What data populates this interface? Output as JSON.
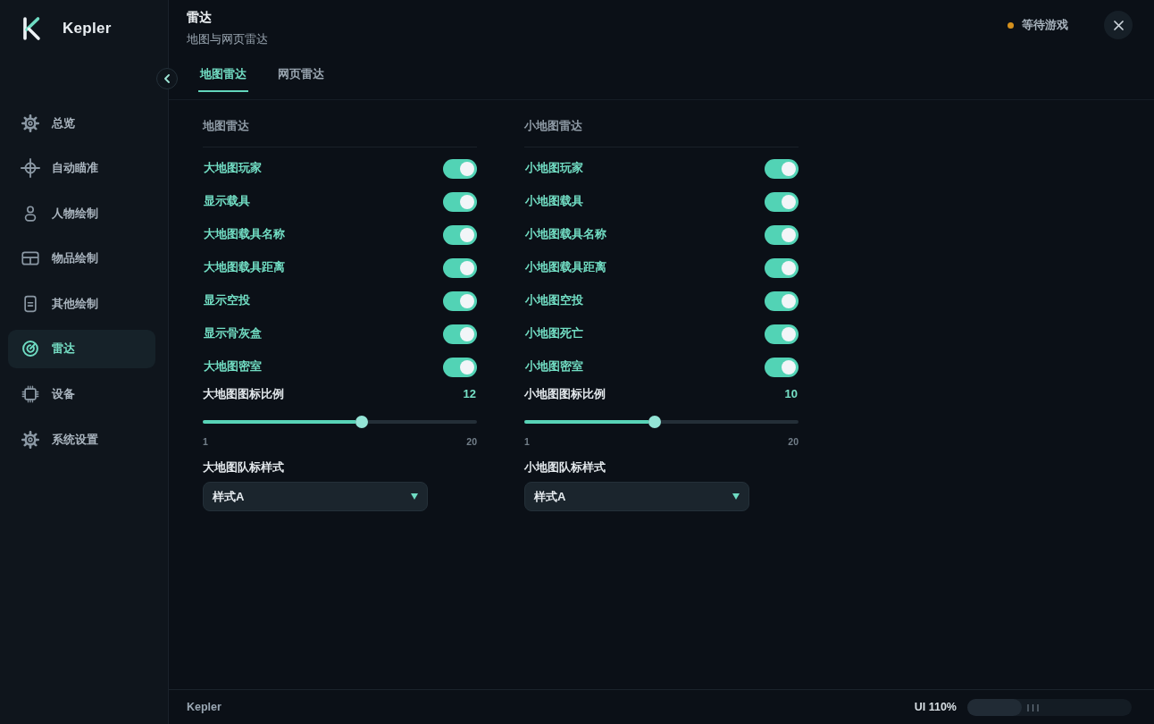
{
  "sidebar": {
    "brand": "Kepler",
    "items": [
      {
        "label": "总览",
        "selected": false
      },
      {
        "label": "自动瞄准",
        "selected": false
      },
      {
        "label": "人物绘制",
        "selected": false
      },
      {
        "label": "物品绘制",
        "selected": false
      },
      {
        "label": "其他绘制",
        "selected": false
      },
      {
        "label": "雷达",
        "selected": true
      },
      {
        "label": "设备",
        "selected": false
      },
      {
        "label": "系统设置",
        "selected": false
      }
    ]
  },
  "header": {
    "title": "雷达",
    "subtitle": "地图与网页雷达",
    "status": "等待游戏"
  },
  "tabs": [
    {
      "label": "地图雷达",
      "selected": true
    },
    {
      "label": "网页雷达",
      "selected": false
    }
  ],
  "panels": [
    {
      "title": "地图雷达",
      "toggles": [
        {
          "label": "大地图玩家",
          "on": true
        },
        {
          "label": "显示载具",
          "on": true
        },
        {
          "label": "大地图载具名称",
          "on": true
        },
        {
          "label": "大地图载具距离",
          "on": true
        },
        {
          "label": "显示空投",
          "on": true
        },
        {
          "label": "显示骨灰盒",
          "on": true
        },
        {
          "label": "大地图密室",
          "on": true
        }
      ],
      "slider": {
        "label": "大地图图标比例",
        "value": "12",
        "level": 0.579,
        "min": "1",
        "max": "20"
      },
      "select": {
        "label": "大地图队标样式",
        "value": "样式A"
      }
    },
    {
      "title": "小地图雷达",
      "toggles": [
        {
          "label": "小地图玩家",
          "on": true
        },
        {
          "label": "小地图载具",
          "on": true
        },
        {
          "label": "小地图载具名称",
          "on": true
        },
        {
          "label": "小地图载具距离",
          "on": true
        },
        {
          "label": "小地图空投",
          "on": true
        },
        {
          "label": "小地图死亡",
          "on": true
        },
        {
          "label": "小地图密室",
          "on": true
        }
      ],
      "slider": {
        "label": "小地图图标比例",
        "value": "10",
        "level": 0.474,
        "min": "1",
        "max": "20"
      },
      "select": {
        "label": "小地图队标样式",
        "value": "样式A"
      }
    }
  ],
  "footer": {
    "brand": "Kepler",
    "ui_scale": {
      "label": "UI 110%",
      "level": 0.33
    }
  }
}
